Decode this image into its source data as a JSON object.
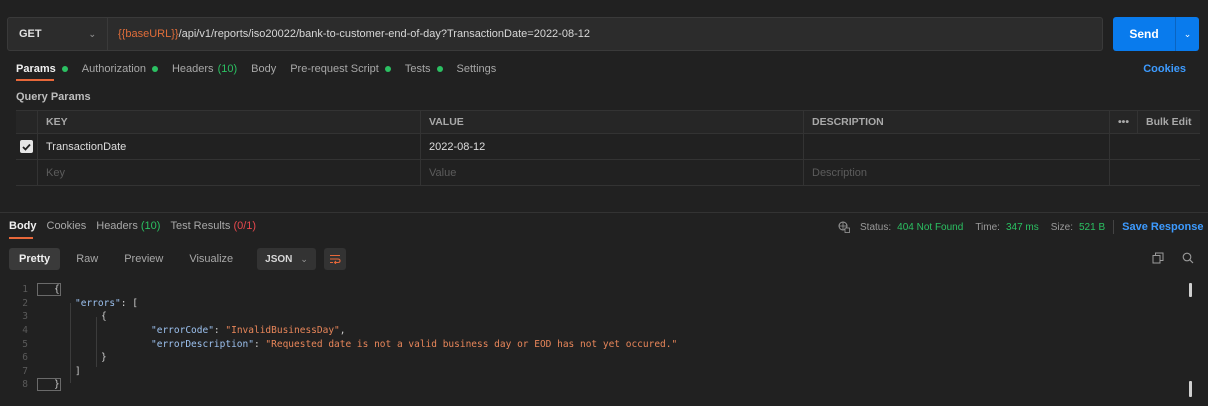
{
  "request": {
    "method": "GET",
    "url_var": "{{baseURL}}",
    "url_rest": "/api/v1/reports/iso20022/bank-to-customer-end-of-day?TransactionDate=2022-08-12",
    "send_label": "Send"
  },
  "tabs": [
    {
      "label": "Params",
      "dot": true
    },
    {
      "label": "Authorization",
      "dot": true
    },
    {
      "label": "Headers",
      "count": "(10)"
    },
    {
      "label": "Body"
    },
    {
      "label": "Pre-request Script",
      "dot": true
    },
    {
      "label": "Tests",
      "dot": true
    },
    {
      "label": "Settings"
    }
  ],
  "cookies_label": "Cookies",
  "query_params_title": "Query Params",
  "params_table": {
    "headers": {
      "key": "KEY",
      "value": "VALUE",
      "description": "DESCRIPTION",
      "more": "•••",
      "bulk_edit": "Bulk Edit"
    },
    "rows": [
      {
        "key": "TransactionDate",
        "value": "2022-08-12",
        "description": "",
        "checked": true
      }
    ],
    "placeholder": {
      "key": "Key",
      "value": "Value",
      "description": "Description"
    }
  },
  "response": {
    "tabs": [
      {
        "label": "Body"
      },
      {
        "label": "Cookies"
      },
      {
        "label": "Headers",
        "count": "(10)"
      },
      {
        "label": "Test Results",
        "count": "(0/1)"
      }
    ],
    "status_label": "Status:",
    "status_value": "404 Not Found",
    "time_label": "Time:",
    "time_value": "347 ms",
    "size_label": "Size:",
    "size_value": "521 B",
    "save_label": "Save Response",
    "formats": [
      "Pretty",
      "Raw",
      "Preview",
      "Visualize"
    ],
    "language": "JSON"
  },
  "body_code": {
    "line_numbers": [
      "1",
      "2",
      "3",
      "4",
      "5",
      "6",
      "7",
      "8"
    ],
    "open_brace": "{",
    "errors_key": "\"errors\"",
    "colon_bracket": ": [",
    "inner_open": "{",
    "code_key": "\"errorCode\"",
    "code_value": "\"InvalidBusinessDay\"",
    "desc_key": "\"errorDescription\"",
    "desc_value": "\"Requested date is not a valid business day or EOD has not yet occured.\"",
    "inner_close": "}",
    "array_close": "]",
    "close_brace": "}"
  },
  "colors": {
    "accent": "#e8683a",
    "send": "#097bed",
    "ok_green": "#2bc062",
    "error": "#e5484d",
    "link": "#3d9bff"
  }
}
